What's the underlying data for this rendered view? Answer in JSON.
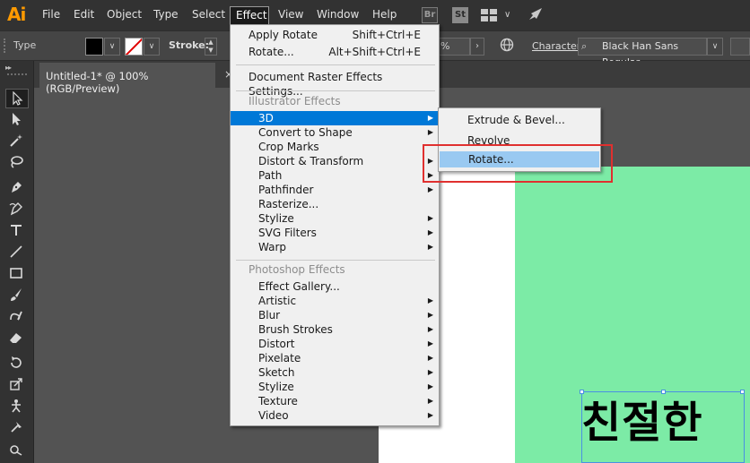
{
  "app": {
    "logo": "Ai"
  },
  "menubar": {
    "items": [
      "File",
      "Edit",
      "Object",
      "Type",
      "Select",
      "Effect",
      "View",
      "Window",
      "Help"
    ],
    "active": "Effect",
    "br_icon": "Br",
    "st_icon": "St",
    "workspace_chevron": "∨"
  },
  "controlbar": {
    "type_label": "Type",
    "stroke_label": "Stroke:",
    "zoom_value": "%",
    "zoom_arrow": "›",
    "character_label": "Character:",
    "font_value": "Black Han Sans Regular",
    "drop_glyph": "∨"
  },
  "document": {
    "tab_title": "Untitled-1* @ 100% (RGB/Preview)",
    "close_glyph": "×",
    "sample_text": "친절한",
    "artboard_color": "#7ceba6"
  },
  "effect_menu": {
    "top": [
      {
        "label": "Apply Rotate",
        "shortcut": "Shift+Ctrl+E"
      },
      {
        "label": "Rotate...",
        "shortcut": "Alt+Shift+Ctrl+E"
      }
    ],
    "raster_settings": "Document Raster Effects Settings...",
    "illustrator_header": "Illustrator Effects",
    "illustrator_items": [
      {
        "label": "3D",
        "submenu": true
      },
      {
        "label": "Convert to Shape",
        "submenu": true
      },
      {
        "label": "Crop Marks",
        "submenu": false
      },
      {
        "label": "Distort & Transform",
        "submenu": true
      },
      {
        "label": "Path",
        "submenu": true
      },
      {
        "label": "Pathfinder",
        "submenu": true
      },
      {
        "label": "Rasterize...",
        "submenu": false
      },
      {
        "label": "Stylize",
        "submenu": true
      },
      {
        "label": "SVG Filters",
        "submenu": true
      },
      {
        "label": "Warp",
        "submenu": true
      }
    ],
    "photoshop_header": "Photoshop Effects",
    "photoshop_items": [
      {
        "label": "Effect Gallery...",
        "submenu": false
      },
      {
        "label": "Artistic",
        "submenu": true
      },
      {
        "label": "Blur",
        "submenu": true
      },
      {
        "label": "Brush Strokes",
        "submenu": true
      },
      {
        "label": "Distort",
        "submenu": true
      },
      {
        "label": "Pixelate",
        "submenu": true
      },
      {
        "label": "Sketch",
        "submenu": true
      },
      {
        "label": "Stylize",
        "submenu": true
      },
      {
        "label": "Texture",
        "submenu": true
      },
      {
        "label": "Video",
        "submenu": true
      }
    ],
    "highlighted": "3D",
    "arrow_glyph": "▶"
  },
  "submenu_3d": {
    "items": [
      "Extrude & Bevel...",
      "Revolve",
      "Rotate..."
    ],
    "highlighted": "Rotate..."
  },
  "colors": {
    "menu_highlight": "#0078d7",
    "submenu_highlight": "#99c9f1",
    "annotation_red": "#e0302f",
    "app_orange": "#ff9a00"
  }
}
